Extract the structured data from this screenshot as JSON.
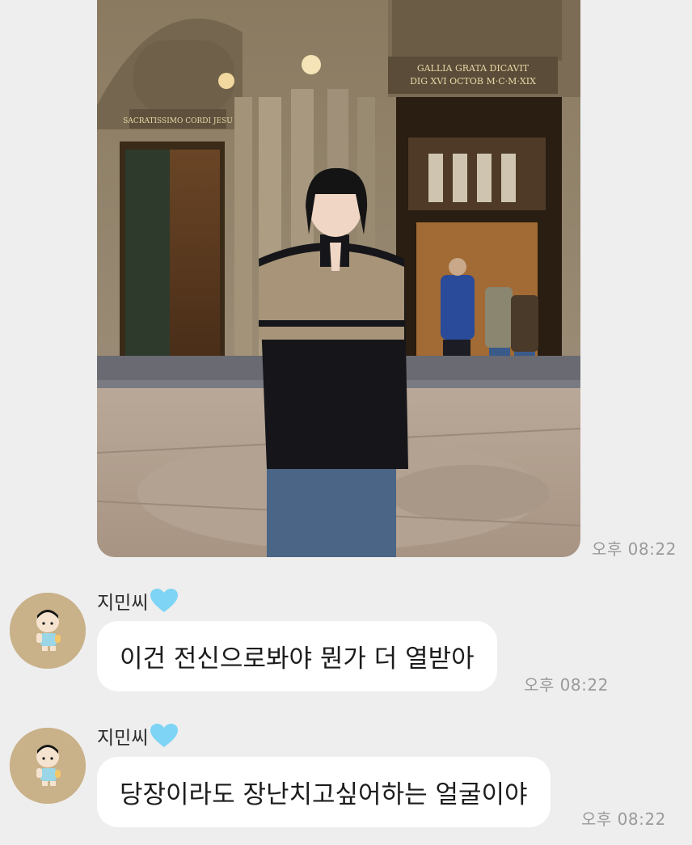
{
  "colors": {
    "background": "#eeeeee",
    "bubble": "#ffffff",
    "timestamp": "#9a9a9a",
    "heart": "#7ed4f5",
    "avatar_bg": "#c9b189"
  },
  "photo_message": {
    "image": "photo-of-person-in-front-of-church-doors",
    "inscription_left": "SACRATISSIMO CORDI JESU",
    "inscription_right_line1": "GALLIA GRATA DICAVIT",
    "inscription_right_line2": "DIG XVI OCTOB M·C·M·XIX",
    "time": "오후 08:22"
  },
  "messages": [
    {
      "sender": "지민씨",
      "sender_icon": "light-blue-heart-icon",
      "avatar_icon": "cartoon-baby-avatar-icon",
      "text": "이건 전신으로봐야 뭔가 더 열받아",
      "time": "오후 08:22"
    },
    {
      "sender": "지민씨",
      "sender_icon": "light-blue-heart-icon",
      "avatar_icon": "cartoon-baby-avatar-icon",
      "text": "당장이라도 장난치고싶어하는 얼굴이야",
      "time": "오후 08:22"
    }
  ]
}
